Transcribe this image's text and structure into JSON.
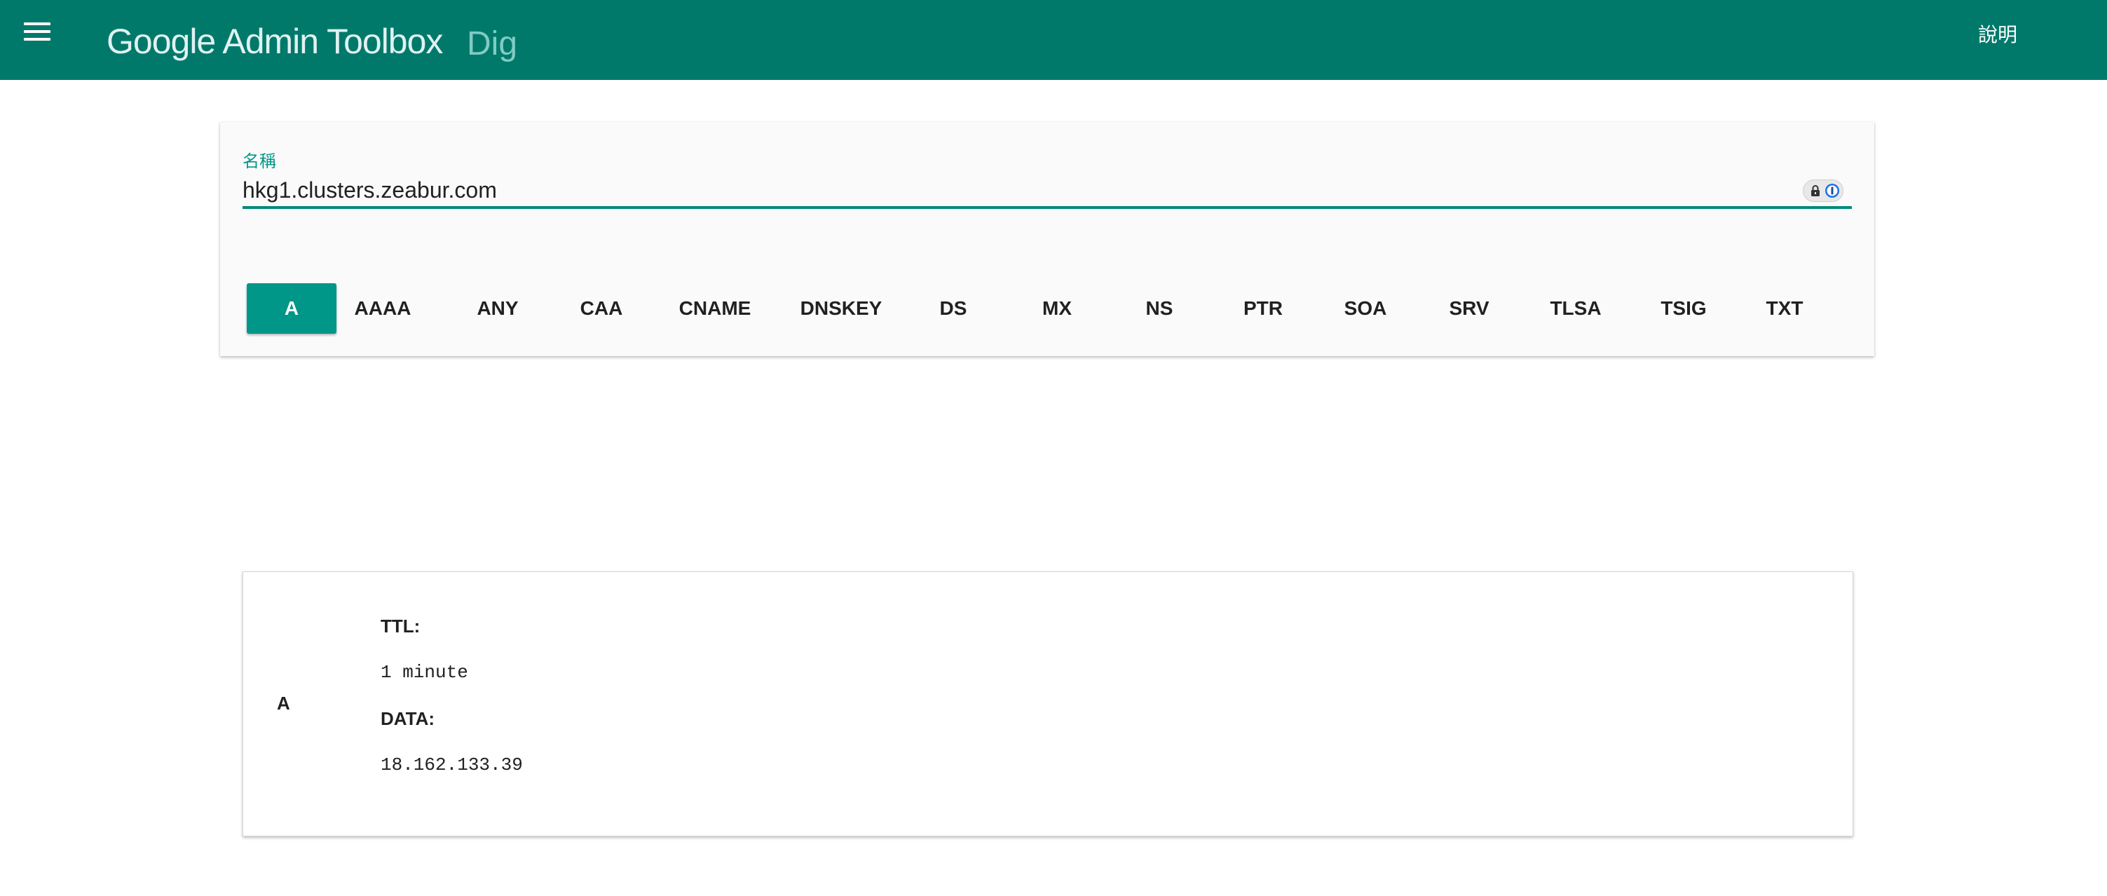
{
  "header": {
    "title": "Google Admin Toolbox",
    "subtitle": "Dig",
    "help_label": "說明",
    "menu_icon": "hamburger-menu-icon",
    "background_color": "#00796b"
  },
  "query": {
    "name_label": "名稱",
    "name_value": "hkg1.clusters.zeabur.com",
    "password_manager_icons": [
      "lock-icon",
      "info-icon"
    ],
    "record_types": [
      {
        "label": "A",
        "selected": true
      },
      {
        "label": "AAAA",
        "selected": false
      },
      {
        "label": "ANY",
        "selected": false
      },
      {
        "label": "CAA",
        "selected": false
      },
      {
        "label": "CNAME",
        "selected": false
      },
      {
        "label": "DNSKEY",
        "selected": false
      },
      {
        "label": "DS",
        "selected": false
      },
      {
        "label": "MX",
        "selected": false
      },
      {
        "label": "NS",
        "selected": false
      },
      {
        "label": "PTR",
        "selected": false
      },
      {
        "label": "SOA",
        "selected": false
      },
      {
        "label": "SRV",
        "selected": false
      },
      {
        "label": "TLSA",
        "selected": false
      },
      {
        "label": "TSIG",
        "selected": false
      },
      {
        "label": "TXT",
        "selected": false
      }
    ],
    "accent_color": "#009688"
  },
  "result": {
    "record_type": "A",
    "ttl_label": "TTL:",
    "ttl_value": "1 minute",
    "data_label": "DATA:",
    "data_value": "18.162.133.39"
  }
}
